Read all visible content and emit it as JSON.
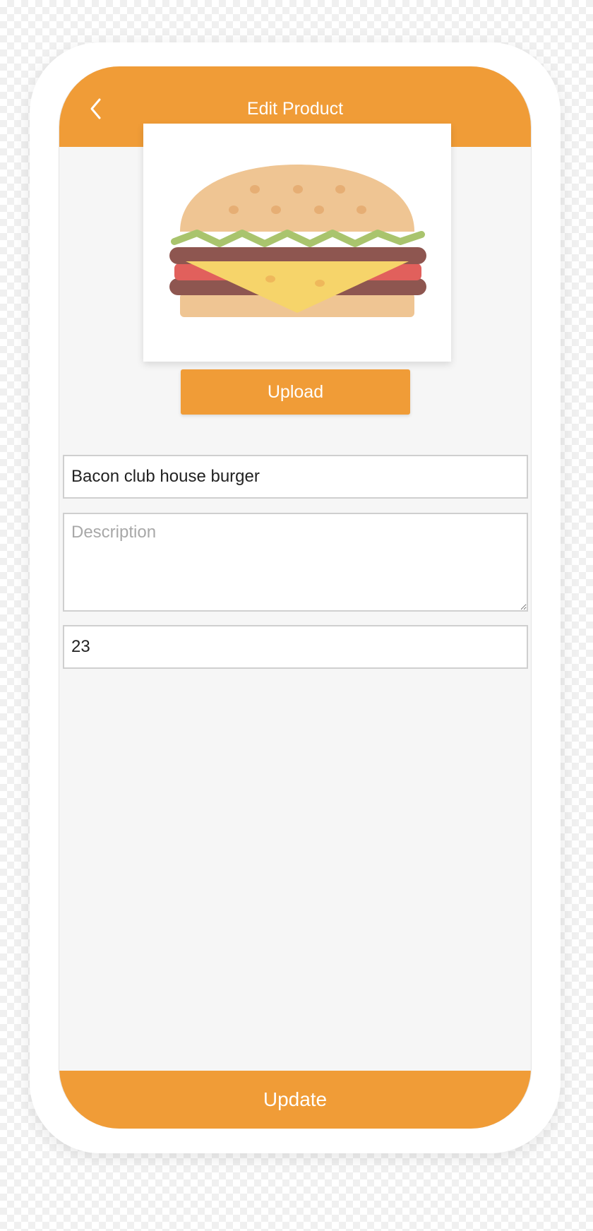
{
  "header": {
    "title": "Edit Product",
    "back_icon": "chevron-left-icon"
  },
  "product": {
    "image": "burger-illustration",
    "upload_label": "Upload",
    "name_value": "Bacon club house burger",
    "description_value": "",
    "description_placeholder": "Description",
    "price_value": "23"
  },
  "footer": {
    "update_label": "Update"
  },
  "colors": {
    "accent": "#f09c37",
    "screen_bg": "#f6f6f6",
    "bun": "#efc593",
    "patty": "#8e5650",
    "lettuce": "#a9c46d",
    "tomato": "#e1605c",
    "cheese": "#f6d46a"
  }
}
